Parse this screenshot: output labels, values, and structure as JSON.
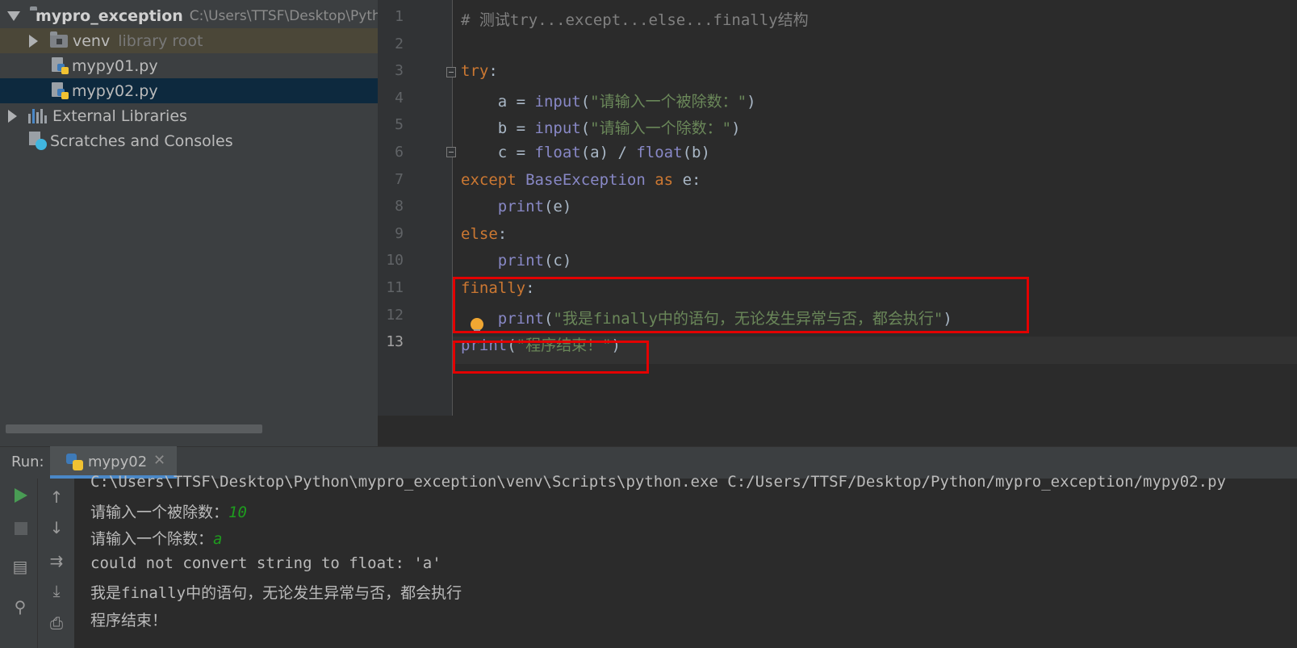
{
  "project_tree": {
    "root": {
      "name": "mypro_exception",
      "path": "C:\\Users\\TTSF\\Desktop\\Pyth"
    },
    "venv": {
      "name": "venv",
      "hint": "library root"
    },
    "files": [
      "mypy01.py",
      "mypy02.py"
    ],
    "selected_file": "mypy02.py",
    "external_libraries": "External Libraries",
    "scratches": "Scratches and Consoles"
  },
  "editor": {
    "current_line": "13",
    "line_numbers": [
      "1",
      "2",
      "3",
      "4",
      "5",
      "6",
      "7",
      "8",
      "9",
      "10",
      "11",
      "12",
      "13"
    ],
    "lines": [
      [
        {
          "t": "# 测试try...except...else...finally结构",
          "c": "com"
        }
      ],
      [],
      [
        {
          "t": "try",
          "c": "kw"
        },
        {
          "t": ":",
          "c": "txt"
        }
      ],
      [
        {
          "t": "    a = ",
          "c": "txt"
        },
        {
          "t": "input",
          "c": "bi"
        },
        {
          "t": "(",
          "c": "txt"
        },
        {
          "t": "\"请输入一个被除数：\"",
          "c": "str"
        },
        {
          "t": ")",
          "c": "txt"
        }
      ],
      [
        {
          "t": "    b = ",
          "c": "txt"
        },
        {
          "t": "input",
          "c": "bi"
        },
        {
          "t": "(",
          "c": "txt"
        },
        {
          "t": "\"请输入一个除数：\"",
          "c": "str"
        },
        {
          "t": ")",
          "c": "txt"
        }
      ],
      [
        {
          "t": "    c = ",
          "c": "txt"
        },
        {
          "t": "float",
          "c": "bi"
        },
        {
          "t": "(a) / ",
          "c": "txt"
        },
        {
          "t": "float",
          "c": "bi"
        },
        {
          "t": "(b)",
          "c": "txt"
        }
      ],
      [
        {
          "t": "except ",
          "c": "kw"
        },
        {
          "t": "BaseException ",
          "c": "bi"
        },
        {
          "t": "as ",
          "c": "kw"
        },
        {
          "t": "e:",
          "c": "txt"
        }
      ],
      [
        {
          "t": "    ",
          "c": "txt"
        },
        {
          "t": "print",
          "c": "bi"
        },
        {
          "t": "(e)",
          "c": "txt"
        }
      ],
      [
        {
          "t": "else",
          "c": "kw"
        },
        {
          "t": ":",
          "c": "txt"
        }
      ],
      [
        {
          "t": "    ",
          "c": "txt"
        },
        {
          "t": "print",
          "c": "bi"
        },
        {
          "t": "(c)",
          "c": "txt"
        }
      ],
      [
        {
          "t": "finally",
          "c": "kw"
        },
        {
          "t": ":",
          "c": "txt"
        }
      ],
      [
        {
          "t": "    ",
          "c": "txt"
        },
        {
          "t": "print",
          "c": "bi"
        },
        {
          "t": "(",
          "c": "txt"
        },
        {
          "t": "\"我是finally中的语句，无论发生异常与否，都会执行\"",
          "c": "str"
        },
        {
          "t": ")",
          "c": "txt"
        }
      ],
      [
        {
          "t": "print",
          "c": "bi"
        },
        {
          "t": "(",
          "c": "txt"
        },
        {
          "t": "\"程序结束！\"",
          "c": "str"
        },
        {
          "t": ")",
          "c": "txt"
        }
      ]
    ]
  },
  "run_panel": {
    "label": "Run:",
    "tab": "mypy02",
    "console": [
      [
        {
          "t": "C:\\Users\\TTSF\\Desktop\\Python\\mypro_exception\\venv\\Scripts\\python.exe C:/Users/TTSF/Desktop/Python/mypro_exception/mypy02.py",
          "c": "out"
        }
      ],
      [
        {
          "t": "请输入一个被除数：",
          "c": "out"
        },
        {
          "t": "10",
          "c": "in"
        }
      ],
      [
        {
          "t": "请输入一个除数：",
          "c": "out"
        },
        {
          "t": "a",
          "c": "in"
        }
      ],
      [
        {
          "t": "could not convert string to float: 'a'",
          "c": "out"
        }
      ],
      [
        {
          "t": "我是finally中的语句，无论发生异常与否，都会执行",
          "c": "out"
        }
      ],
      [
        {
          "t": "程序结束！",
          "c": "out"
        }
      ]
    ]
  },
  "colors": {
    "keyword": "#cc7832",
    "builtin": "#8888c6",
    "string": "#6a8759",
    "comment": "#808080",
    "console_input": "#1e9c1e",
    "highlight_box": "#e30000"
  }
}
